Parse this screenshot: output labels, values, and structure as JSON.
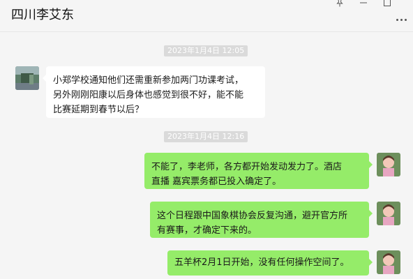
{
  "header": {
    "title": "四川李艾东",
    "controls": {
      "pin_icon": "pin-icon",
      "minimize_icon": "minimize-icon",
      "maximize_icon": "maximize-icon",
      "more_icon": "more-icon"
    }
  },
  "messages": [
    {
      "type": "timestamp",
      "text": "2023年1月4日 12:05"
    },
    {
      "type": "message",
      "side": "left",
      "avatar": "contact-avatar",
      "lines": [
        "小郑学校通知他们还需重新参加两门功课考试，",
        "另外刚刚阳康以后身体也感觉到很不好，能不能",
        "比赛延期到春节以后？"
      ]
    },
    {
      "type": "timestamp",
      "text": "2023年1月4日 12:16"
    },
    {
      "type": "message",
      "side": "right",
      "avatar": "own-avatar",
      "lines": [
        "不能了，李老师，各方都开始发动发力了。酒店",
        "直播   嘉宾票务都已投入确定了。"
      ]
    },
    {
      "type": "message",
      "side": "right",
      "avatar": "own-avatar",
      "lines": [
        "这个日程跟中国象棋协会反复沟通，避开官方所",
        "有赛事，才确定下来的。"
      ]
    },
    {
      "type": "message",
      "side": "right",
      "avatar": "own-avatar",
      "lines": [
        "五羊杯2月1日开始，没有任何操作空间了。"
      ]
    }
  ],
  "colors": {
    "background": "#f5f5f5",
    "bubble_right": "#95ec69",
    "bubble_left": "#ffffff",
    "timestamp_bg": "#dadada"
  }
}
